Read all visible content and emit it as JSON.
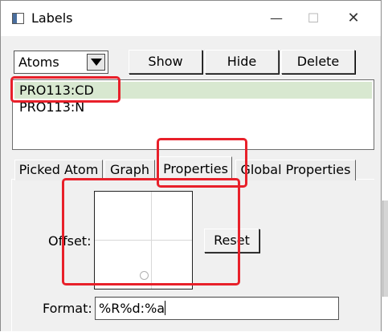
{
  "window": {
    "title": "Labels",
    "icon": "app-window-icon",
    "controls": {
      "minimize": "—",
      "maximize": "☐",
      "close": "✕"
    }
  },
  "toolbar": {
    "selector": {
      "value": "Atoms",
      "icon": "dropdown-arrow-icon"
    },
    "show_label": "Show",
    "hide_label": "Hide",
    "delete_label": "Delete"
  },
  "labels_list": {
    "items": [
      {
        "text": "PRO113:CD",
        "selected": true
      },
      {
        "text": "PRO113:N",
        "selected": false
      }
    ]
  },
  "tabs": [
    {
      "label": "Picked Atom",
      "active": false
    },
    {
      "label": "Graph",
      "active": false
    },
    {
      "label": "Properties",
      "active": true
    },
    {
      "label": "Global Properties",
      "active": false
    }
  ],
  "properties": {
    "offset_label": "Offset:",
    "reset_label": "Reset",
    "format_label": "Format:",
    "format_value": "%R%d:%a"
  },
  "colors": {
    "highlight": "#e8202a",
    "selection": "#d8e8d0",
    "window_bg": "#f0f0f0"
  }
}
